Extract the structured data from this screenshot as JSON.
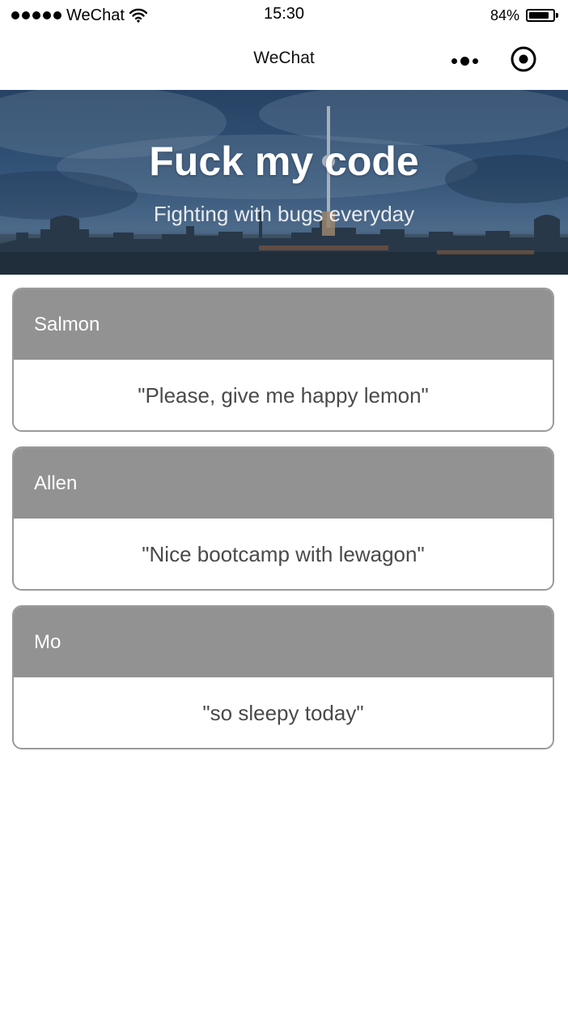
{
  "status_bar": {
    "carrier": "WeChat",
    "time": "15:30",
    "battery": "84%",
    "battery_level": 0.84,
    "icons": [
      "signal-dots-icon",
      "wifi-icon",
      "battery-icon"
    ]
  },
  "nav": {
    "title": "WeChat",
    "icons": [
      "more-icon",
      "close-target-icon"
    ]
  },
  "banner": {
    "title": "Fuck my code",
    "subtitle": "Fighting with bugs everyday"
  },
  "cards": [
    {
      "name": "Salmon",
      "quote": "\"Please, give me happy lemon\""
    },
    {
      "name": "Allen",
      "quote": "\"Nice bootcamp with lewagon\""
    },
    {
      "name": "Mo",
      "quote": "\"so sleepy today\""
    }
  ],
  "colors": {
    "card_header": "#929292",
    "card_border": "#9a9a9a",
    "quote_text": "#4a4a4a",
    "banner_sky": "#1f3f66"
  }
}
